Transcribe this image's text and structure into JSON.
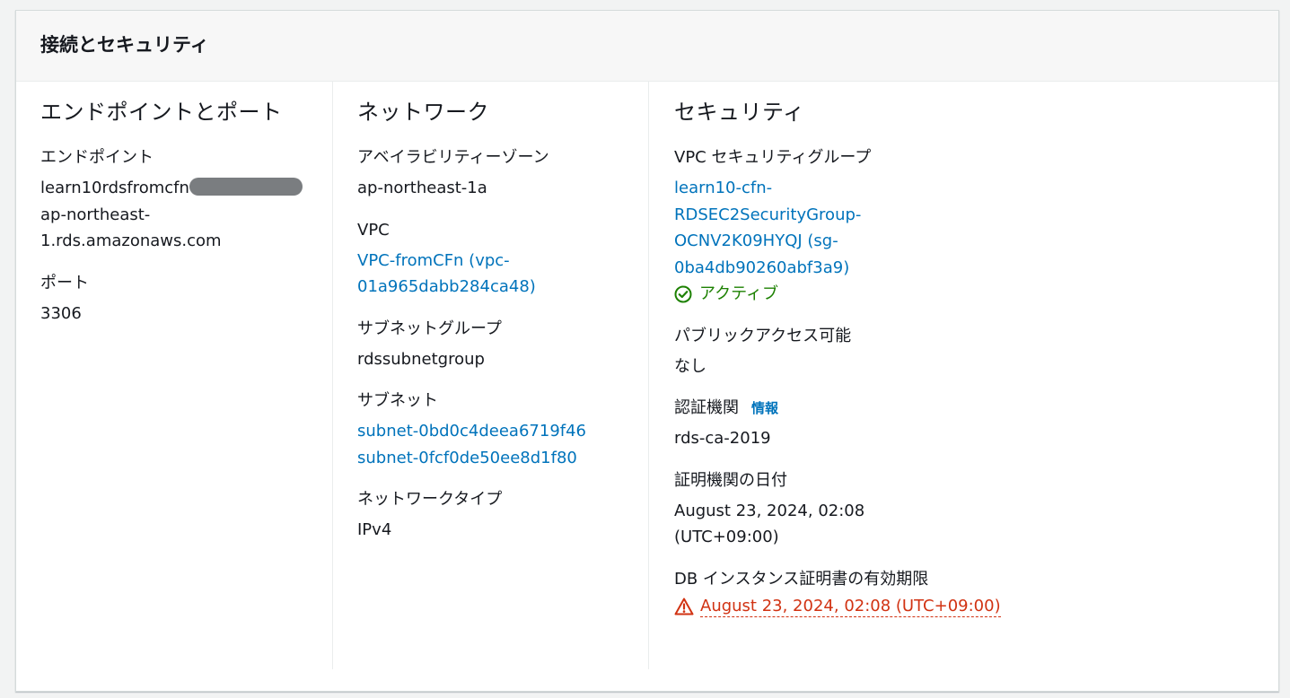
{
  "panel": {
    "title": "接続とセキュリティ"
  },
  "endpoint_port": {
    "title": "エンドポイントとポート",
    "endpoint_label": "エンドポイント",
    "endpoint_value_line1": "learn10rdsfromcfn",
    "endpoint_value_line2": "ap-northeast-",
    "endpoint_value_line3": "1.rds.amazonaws.com",
    "port_label": "ポート",
    "port_value": "3306"
  },
  "network": {
    "title": "ネットワーク",
    "az_label": "アベイラビリティーゾーン",
    "az_value": "ap-northeast-1a",
    "vpc_label": "VPC",
    "vpc_value_line1": "VPC-fromCFn (vpc-",
    "vpc_value_line2": "01a965dabb284ca48)",
    "subnet_group_label": "サブネットグループ",
    "subnet_group_value": "rdssubnetgroup",
    "subnets_label": "サブネット",
    "subnets": [
      "subnet-0bd0c4deea6719f46",
      "subnet-0fcf0de50ee8d1f80"
    ],
    "network_type_label": "ネットワークタイプ",
    "network_type_value": "IPv4"
  },
  "security": {
    "title": "セキュリティ",
    "sg_label": "VPC セキュリティグループ",
    "sg_value_lines": [
      "learn10-cfn-",
      "RDSEC2SecurityGroup-",
      "OCNV2K09HYQJ (sg-",
      "0ba4db90260abf3a9)"
    ],
    "sg_status": "アクティブ",
    "public_access_label": "パブリックアクセス可能",
    "public_access_value": "なし",
    "ca_label": "認証機関",
    "ca_info": "情報",
    "ca_value": "rds-ca-2019",
    "ca_date_label": "証明機関の日付",
    "ca_date_line1": "August 23, 2024, 02:08",
    "ca_date_line2": "(UTC+09:00)",
    "cert_expiry_label": "DB インスタンス証明書の有効期限",
    "cert_expiry_value": "August 23, 2024, 02:08 (UTC+09:00)"
  },
  "colors": {
    "link": "#0073bb",
    "success": "#1d8102",
    "error": "#d13212"
  },
  "icons": {
    "sg_status": "check-circle-icon",
    "cert_expiry": "warning-icon"
  }
}
